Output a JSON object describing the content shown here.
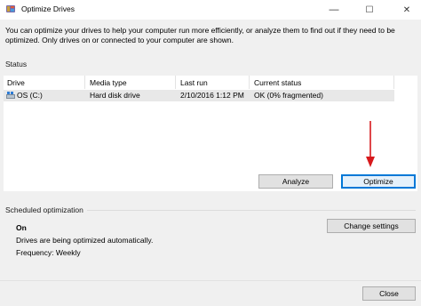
{
  "window": {
    "title": "Optimize Drives",
    "controls": {
      "minimize": "—",
      "maximize": "☐",
      "close": "✕"
    }
  },
  "description": "You can optimize your drives to help your computer run more efficiently, or analyze them to find out if they need to be optimized. Only drives on or connected to your computer are shown.",
  "status": {
    "label": "Status",
    "columns": [
      "Drive",
      "Media type",
      "Last run",
      "Current status"
    ],
    "drives": [
      {
        "drive": "OS (C:)",
        "media_type": "Hard disk drive",
        "last_run": "2/10/2016 1:12 PM",
        "current_status": "OK (0% fragmented)",
        "icon": "hard-drive-icon"
      }
    ]
  },
  "buttons": {
    "analyze": "Analyze",
    "optimize": "Optimize",
    "change_settings": "Change settings",
    "close": "Close"
  },
  "scheduled": {
    "label": "Scheduled optimization",
    "state": "On",
    "description": "Drives are being optimized automatically.",
    "frequency": "Frequency: Weekly"
  },
  "colors": {
    "arrow": "#d7191c",
    "accent": "#0078d7"
  }
}
